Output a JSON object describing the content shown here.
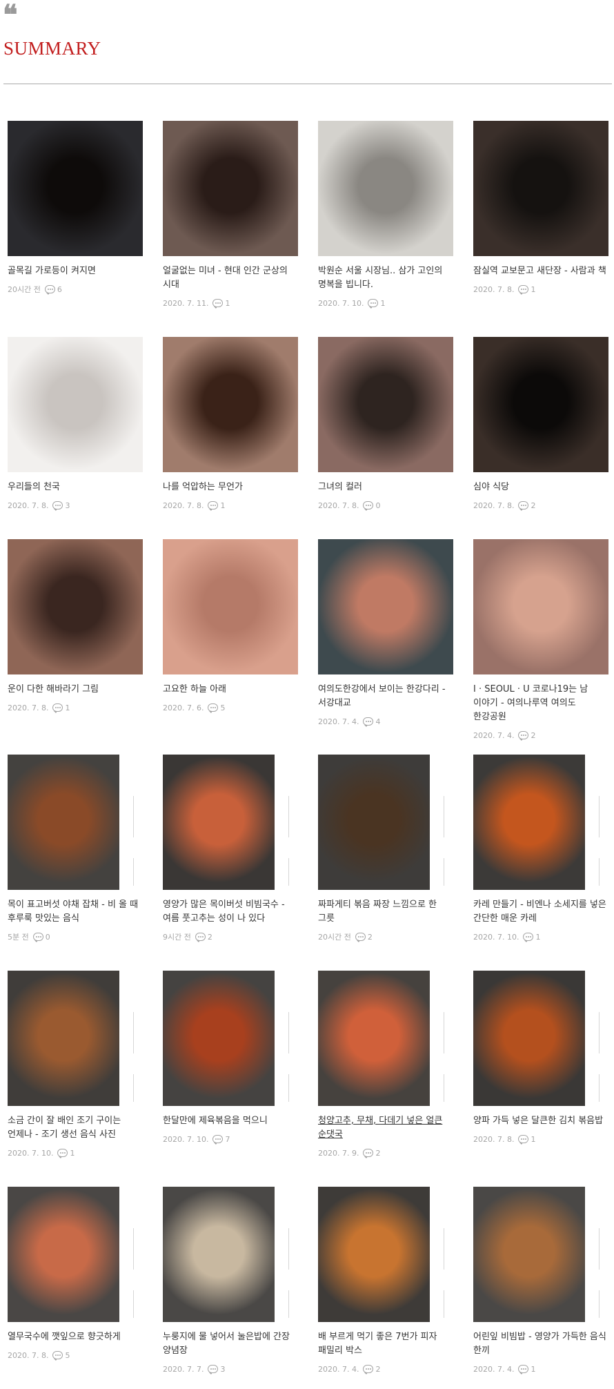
{
  "header": {
    "quote_mark": "❝",
    "title": "SUMMARY"
  },
  "posts": [
    {
      "title": "골목길 가로등이 켜지면",
      "date": "20시간 전",
      "comments": "6",
      "thumb": "photo-street-night",
      "colors": [
        "#2a2a2e",
        "#0e0b0a"
      ]
    },
    {
      "title": "얼굴없는 미녀 - 현대 인간 군상의 시대",
      "date": "2020. 7. 11.",
      "comments": "1",
      "thumb": "photo-blurred-figure",
      "colors": [
        "#6e5a52",
        "#2a1c18"
      ]
    },
    {
      "title": "박원순 서울 시장님.. 삼가 고인의 명복을 빕니다.",
      "date": "2020. 7. 10.",
      "comments": "1",
      "thumb": "photo-white-flowers",
      "colors": [
        "#d4d2cd",
        "#8a8782"
      ]
    },
    {
      "title": "잠실역 교보문고 새단장 - 사람과 책",
      "date": "2020. 7. 8.",
      "comments": "1",
      "thumb": "photo-bookstore",
      "colors": [
        "#3a2f2a",
        "#151210"
      ]
    },
    {
      "title": "우리들의 천국",
      "date": "2020. 7. 8.",
      "comments": "3",
      "thumb": "photo-white-store",
      "colors": [
        "#f2f0ee",
        "#c9c4c0"
      ]
    },
    {
      "title": "나를 억압하는 무언가",
      "date": "2020. 7. 8.",
      "comments": "1",
      "thumb": "photo-hair-portrait",
      "colors": [
        "#a07c6c",
        "#3a2218"
      ]
    },
    {
      "title": "그녀의 컬러",
      "date": "2020. 7. 8.",
      "comments": "0",
      "thumb": "photo-escalator",
      "colors": [
        "#8a6a62",
        "#2e2420"
      ]
    },
    {
      "title": "심야 식당",
      "date": "2020. 7. 8.",
      "comments": "2",
      "thumb": "photo-night-restaurant",
      "colors": [
        "#3a2e28",
        "#0c0a09"
      ]
    },
    {
      "title": "운이 다한 해바라기 그림",
      "date": "2020. 7. 8.",
      "comments": "1",
      "thumb": "photo-sunflower-painting",
      "colors": [
        "#8f6656",
        "#3a2620"
      ]
    },
    {
      "title": "고요한 하늘 아래",
      "date": "2020. 7. 6.",
      "comments": "5",
      "thumb": "photo-pink-sky",
      "colors": [
        "#d9a08c",
        "#b57a68"
      ]
    },
    {
      "title": "여의도한강에서 보이는 한강다리 - 서강대교",
      "date": "2020. 7. 4.",
      "comments": "4",
      "thumb": "photo-han-river-bridge",
      "colors": [
        "#3e4a4e",
        "#c07a64"
      ]
    },
    {
      "title": "I · SEOUL · U 코로나19는 남 이야기 - 여의나루역 여의도 한강공원",
      "date": "2020. 7. 4.",
      "comments": "2",
      "thumb": "photo-han-river-park",
      "colors": [
        "#9a7268",
        "#d6a28e"
      ]
    },
    {
      "title": "목이 표고버섯 야채 잡채 - 비 올 때 후루룩 맛있는 음식",
      "date": "5분 전",
      "comments": "0",
      "thumb": "food-japchae",
      "colors": [
        "#44423f",
        "#8a4a28"
      ]
    },
    {
      "title": "영양가 많은 목이버섯 비빔국수 - 여름 풋고추는 성이 나 있다",
      "date": "9시간 전",
      "comments": "2",
      "thumb": "food-bibim-guksu",
      "colors": [
        "#3a3735",
        "#c8603a"
      ]
    },
    {
      "title": "짜파게티 볶음 짜장 느낌으로 한 그릇",
      "date": "20시간 전",
      "comments": "2",
      "thumb": "food-jjapagetti",
      "colors": [
        "#3e3c3a",
        "#4a3422"
      ]
    },
    {
      "title": "카레 만들기 - 비엔나 소세지를 넣은 간단한 매운 카레",
      "date": "2020. 7. 10.",
      "comments": "1",
      "thumb": "food-curry",
      "colors": [
        "#3c3a38",
        "#c4561e"
      ]
    },
    {
      "title": "소금 간이 잘 배인 조기 구이는 언제나 - 조기 생선 음식 사진",
      "date": "2020. 7. 10.",
      "comments": "1",
      "thumb": "food-grilled-fish",
      "colors": [
        "#403d3a",
        "#9a5a30"
      ]
    },
    {
      "title": "한달만에 제육볶음을 먹으니",
      "date": "2020. 7. 10.",
      "comments": "7",
      "thumb": "food-jeyuk",
      "colors": [
        "#454341",
        "#a8401e"
      ]
    },
    {
      "title": "청양고추, 무채, 다데기 넣은 얼큰 순댓국",
      "date": "2020. 7. 9.",
      "comments": "2",
      "thumb": "food-sundaeguk",
      "colors": [
        "#46423e",
        "#d0603a"
      ],
      "underline": true
    },
    {
      "title": "양파 가득 넣은 달큰한 김치 볶음밥",
      "date": "2020. 7. 8.",
      "comments": "1",
      "thumb": "food-kimchi-rice",
      "colors": [
        "#3a3836",
        "#b4501e"
      ]
    },
    {
      "title": "열무국수에 깻잎으로 향긋하게",
      "date": "2020. 7. 8.",
      "comments": "5",
      "thumb": "food-yeolmu-noodle",
      "colors": [
        "#4a4745",
        "#c86a48"
      ]
    },
    {
      "title": "누룽지에 물 넣어서 눌은밥에 간장 양념장",
      "date": "2020. 7. 7.",
      "comments": "3",
      "thumb": "food-nurungji",
      "colors": [
        "#4a4846",
        "#c8b8a0"
      ]
    },
    {
      "title": "배 부르게 먹기 좋은 7번가 피자 패밀리 박스",
      "date": "2020. 7. 4.",
      "comments": "2",
      "thumb": "food-pizza",
      "colors": [
        "#3e3b38",
        "#c87430"
      ]
    },
    {
      "title": "어린잎 비빔밥 - 영양가 가득한 음식 한끼",
      "date": "2020. 7. 4.",
      "comments": "1",
      "thumb": "food-bibimbap",
      "colors": [
        "#4a4846",
        "#a86a3a"
      ]
    }
  ],
  "icons": {
    "comment": "speech-bubble-icon"
  }
}
